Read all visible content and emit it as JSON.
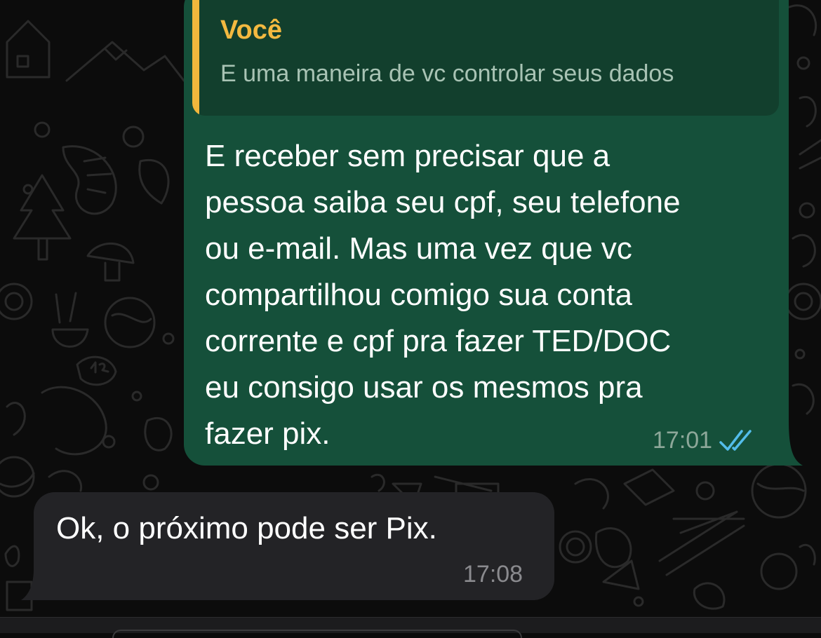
{
  "conversation": {
    "outgoing_message": {
      "quoted": {
        "author": "Você",
        "text": "E uma maneira de vc controlar seus dados"
      },
      "lines": [
        "E receber sem precisar que a",
        "pessoa saiba seu cpf, seu telefone",
        "ou e-mail. Mas uma vez que vc",
        "compartilhou comigo sua conta",
        "corrente e cpf pra fazer TED/DOC",
        "eu consigo usar os mesmos pra",
        "fazer pix."
      ],
      "time": "17:01",
      "status_icon": "double-check-read-icon"
    },
    "incoming_message": {
      "text": "Ok, o próximo pode ser Pix.",
      "time": "17:08"
    }
  },
  "colors": {
    "outgoing_bubble": "#15503a",
    "quote_background": "#123f2d",
    "quote_accent": "#f0b73c",
    "incoming_bubble": "#232326",
    "read_ticks": "#53bdeb"
  }
}
